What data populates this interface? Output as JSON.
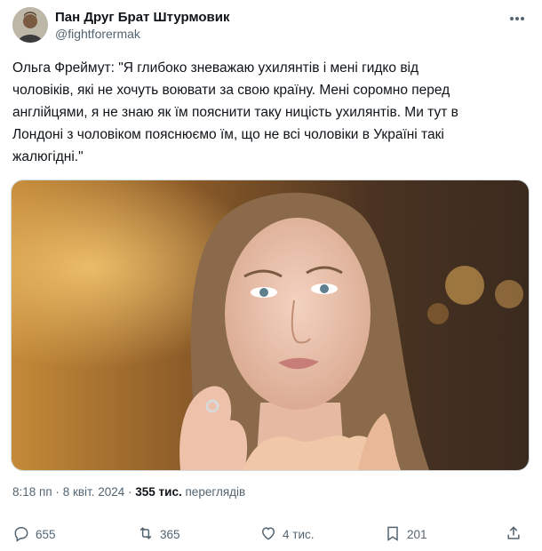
{
  "author": {
    "display_name": "Пан Друг Брат Штурмовик",
    "handle": "@fightforermak"
  },
  "tweet": {
    "text": "Ольга Фреймут: \"Я глибоко зневажаю ухилянтів і мені гидко від\nчоловіків, які не хочуть воювати за свою країну. Мені соромно перед\nанглійцями, я не знаю як їм пояснити таку ницість ухилянтів. Ми тут в\nЛондоні з чоловіком пояснюємо їм, що не всі чоловіки в Україні такі\nжалюгідні.\""
  },
  "meta": {
    "time": "8:18 пп",
    "separator": "·",
    "date": "8 квіт. 2024",
    "views_count": "355 тис.",
    "views_label": "переглядів"
  },
  "actions": {
    "replies": "655",
    "reposts": "365",
    "likes": "4 тис.",
    "bookmarks": "201"
  },
  "icons": [
    "more-icon",
    "reply-icon",
    "repost-icon",
    "like-icon",
    "bookmark-icon",
    "share-icon"
  ],
  "colors": {
    "text": "#0f1419",
    "secondary": "#536471",
    "border": "#cfd9de"
  }
}
